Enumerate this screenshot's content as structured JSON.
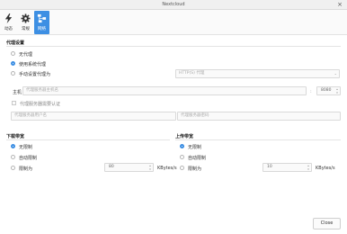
{
  "window": {
    "title": "Nextcloud",
    "close_glyph": "×"
  },
  "toolbar": {
    "items": [
      {
        "label": "动态",
        "icon": "activity-icon"
      },
      {
        "label": "常规",
        "icon": "gear-icon"
      },
      {
        "label": "网络",
        "icon": "network-icon"
      }
    ],
    "active_index": 2,
    "accent": "#3d8fe3"
  },
  "proxy": {
    "heading": "代理设置",
    "options": [
      "无代理",
      "使用系统代理",
      "手动设置代理为"
    ],
    "selected_index": 1,
    "type_dropdown": {
      "value": "HTTP(S) 代理"
    },
    "host_label": "主机",
    "host_placeholder": "代理服务器主机名",
    "port_separator": ":",
    "port_value": "8080",
    "auth_label": "代理服务器需要认证",
    "user_placeholder": "代理服务器用户名",
    "password_placeholder": "代理服务器密码"
  },
  "download": {
    "heading": "下载带宽",
    "options": [
      "无限制",
      "自动限制",
      "限制为"
    ],
    "selected_index": 0,
    "limit_value": "80",
    "unit": "KBytes/s"
  },
  "upload": {
    "heading": "上传带宽",
    "options": [
      "无限制",
      "自动限制",
      "限制为"
    ],
    "selected_index": 0,
    "limit_value": "10",
    "unit": "KBytes/s"
  },
  "footer": {
    "close_label": "Close"
  }
}
